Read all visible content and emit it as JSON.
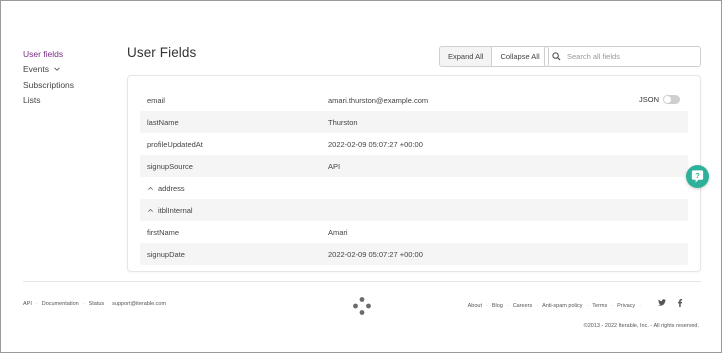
{
  "nav": {
    "items": [
      {
        "label": "User fields",
        "active": true
      },
      {
        "label": "Events",
        "has_chevron": true
      },
      {
        "label": "Subscriptions"
      },
      {
        "label": "Lists"
      }
    ]
  },
  "header": {
    "title": "User Fields",
    "expand_all": "Expand All",
    "collapse_all": "Collapse All",
    "search_placeholder": "Search all fields"
  },
  "card": {
    "json_label": "JSON",
    "json_enabled": false,
    "rows": [
      {
        "key": "email",
        "value": "amari.thurston@example.com",
        "alt": false
      },
      {
        "key": "lastName",
        "value": "Thurston",
        "alt": true
      },
      {
        "key": "profileUpdatedAt",
        "value": "2022-02-09 05:07:27 +00:00",
        "alt": false
      },
      {
        "key": "signupSource",
        "value": "API",
        "alt": true
      },
      {
        "key": "address",
        "value": "",
        "alt": false,
        "collapsible": true
      },
      {
        "key": "itblInternal",
        "value": "",
        "alt": true,
        "collapsible": true
      },
      {
        "key": "firstName",
        "value": "Amari",
        "alt": false
      },
      {
        "key": "signupDate",
        "value": "2022-02-09 05:07:27 +00:00",
        "alt": true
      }
    ]
  },
  "footer": {
    "left_links": [
      "API",
      "Documentation",
      "Status",
      "support@iterable.com"
    ],
    "right_links": [
      "About",
      "Blog",
      "Careers",
      "Anti-spam policy",
      "Terms",
      "Privacy"
    ],
    "copyright": "©2013 - 2022 Iterable, Inc. - All rights reserved."
  },
  "colors": {
    "accent": "#7a2a86",
    "help": "#2fb09a"
  }
}
